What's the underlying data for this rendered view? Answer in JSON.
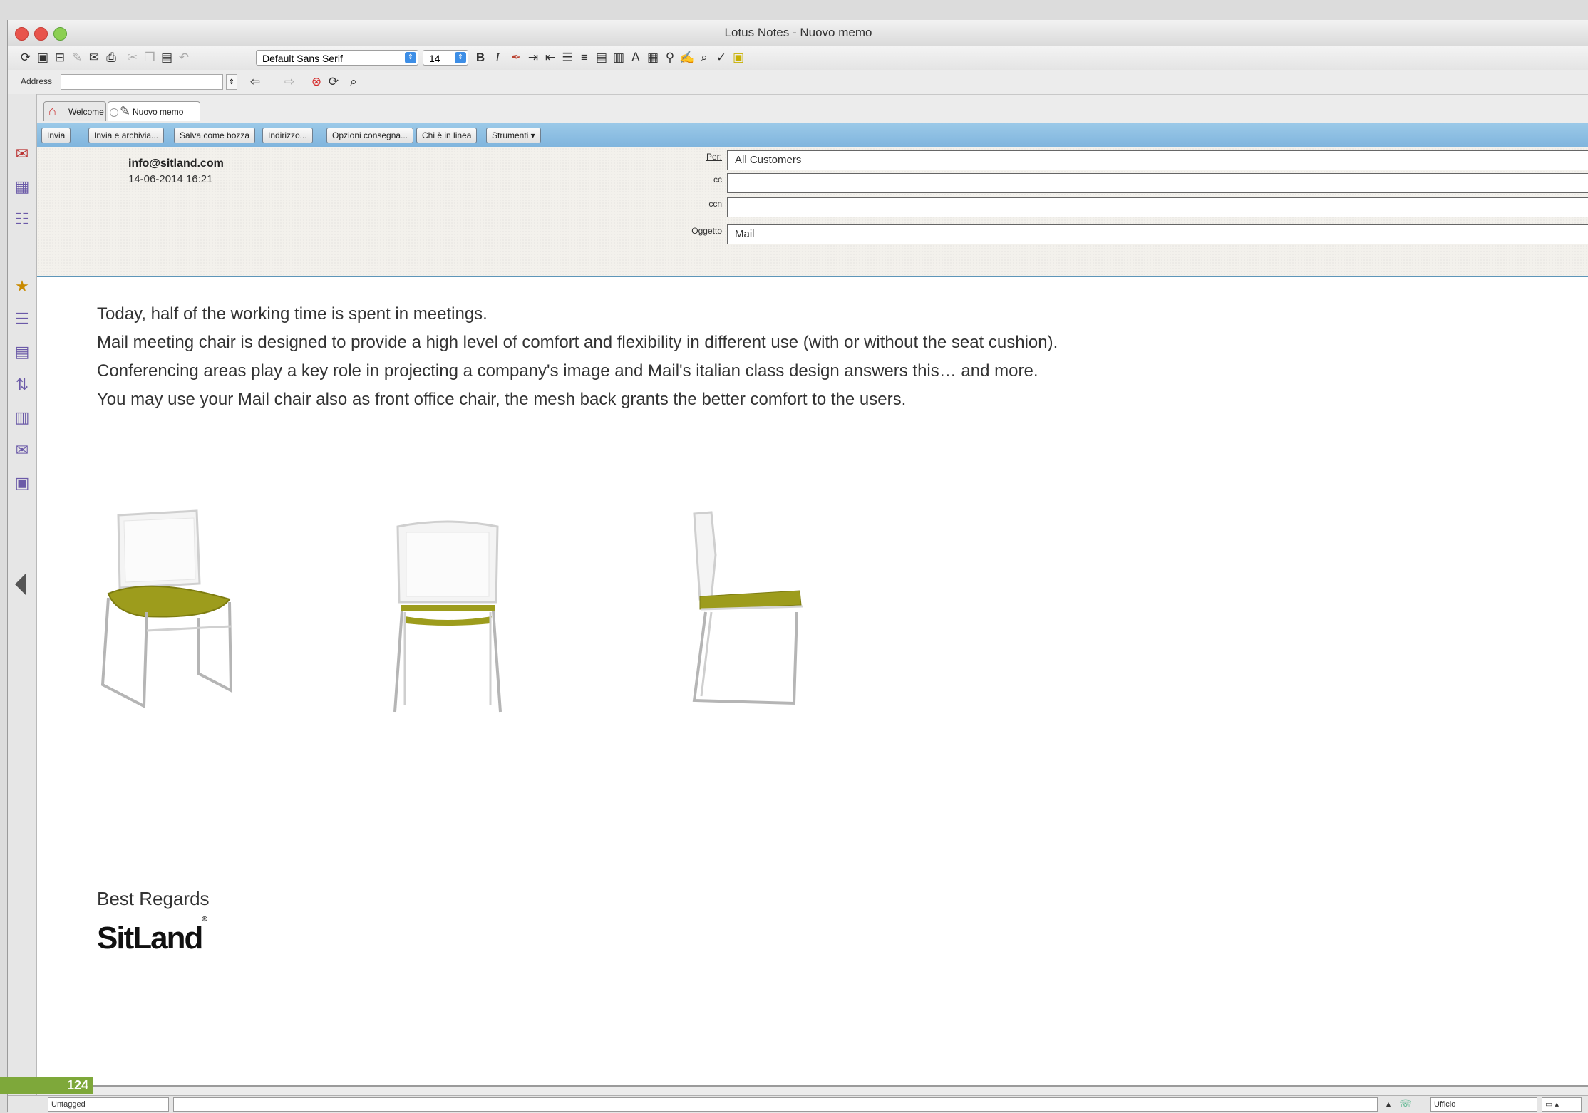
{
  "window": {
    "title": "Lotus Notes - Nuovo memo"
  },
  "toolbar": {
    "font": "Default Sans Serif",
    "size": "14",
    "bold": "B",
    "italic": "I"
  },
  "address_bar": {
    "label": "Address",
    "value": ""
  },
  "tabs": [
    {
      "label": "Welcome",
      "icon": "home-icon"
    },
    {
      "label": "Nuovo memo",
      "icon": "memo-icon"
    }
  ],
  "actions": [
    "Invia",
    "Invia e archivia...",
    "Salva come bozza",
    "Indirizzo...",
    "Opzioni consegna...",
    "Chi è in linea",
    "Strumenti ▾"
  ],
  "header": {
    "from": "info@sitland.com",
    "date": "14-06-2014 16:21",
    "fields": [
      {
        "label": "Per:",
        "value": "All Customers"
      },
      {
        "label": "cc",
        "value": ""
      },
      {
        "label": "ccn",
        "value": ""
      },
      {
        "label": "Oggetto",
        "value": "Mail"
      }
    ]
  },
  "body": {
    "paragraphs": [
      "Today, half of the working time is spent in meetings.",
      "Mail meeting chair is designed to provide a high level of comfort and flexibility in different use (with or without the seat cushion).",
      "Conferencing areas play a key role in projecting a company's image and Mail's italian class design answers this… and  more.",
      "You may use your Mail chair also as front office chair, the mesh back grants the better comfort to the users."
    ],
    "regards": "Best Regards",
    "logo": "SitLand"
  },
  "statusbar": {
    "tag": "Untagged",
    "location": "Ufficio"
  },
  "page_number": "124"
}
